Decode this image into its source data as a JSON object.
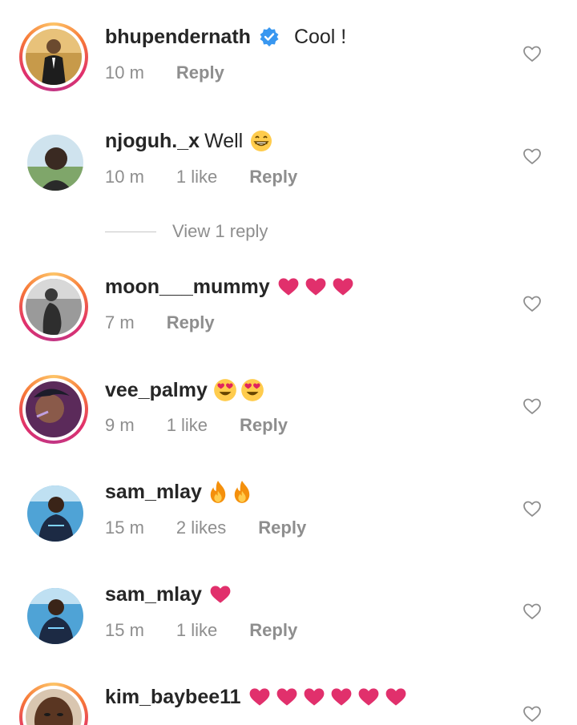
{
  "colors": {
    "heart": "#e1306c",
    "muted": "#8e8e8e",
    "verified": "#3897f0"
  },
  "comments": [
    {
      "username": "bhupendernath",
      "verified": true,
      "text": "Cool !",
      "emoji": [],
      "time": "10 m",
      "likes": "",
      "reply": "Reply",
      "avatar_ring": true
    },
    {
      "username": "njoguh._x",
      "verified": false,
      "text": "Well",
      "emoji": [
        "grin-emoji"
      ],
      "time": "10 m",
      "likes": "1 like",
      "reply": "Reply",
      "avatar_ring": false
    },
    {
      "username": "moon___mummy",
      "verified": false,
      "text": "",
      "emoji": [
        "heart-emoji",
        "heart-emoji",
        "heart-emoji"
      ],
      "time": "7 m",
      "likes": "",
      "reply": "Reply",
      "avatar_ring": true
    },
    {
      "username": "vee_palmy",
      "verified": false,
      "text": "",
      "emoji": [
        "heart-eyes-emoji",
        "heart-eyes-emoji"
      ],
      "time": "9 m",
      "likes": "1 like",
      "reply": "Reply",
      "avatar_ring": true
    },
    {
      "username": "sam_mlay",
      "verified": false,
      "text": "",
      "emoji": [
        "fire-emoji",
        "fire-emoji"
      ],
      "time": "15 m",
      "likes": "2 likes",
      "reply": "Reply",
      "avatar_ring": false
    },
    {
      "username": "sam_mlay",
      "verified": false,
      "text": "",
      "emoji": [
        "heart-emoji"
      ],
      "time": "15 m",
      "likes": "1 like",
      "reply": "Reply",
      "avatar_ring": false
    },
    {
      "username": "kim_baybee11",
      "verified": false,
      "text": "",
      "emoji": [
        "heart-emoji",
        "heart-emoji",
        "heart-emoji",
        "heart-emoji",
        "heart-emoji",
        "heart-emoji"
      ],
      "time": "",
      "likes": "",
      "reply": "",
      "avatar_ring": true
    }
  ],
  "view_replies": {
    "label": "View 1 reply"
  }
}
